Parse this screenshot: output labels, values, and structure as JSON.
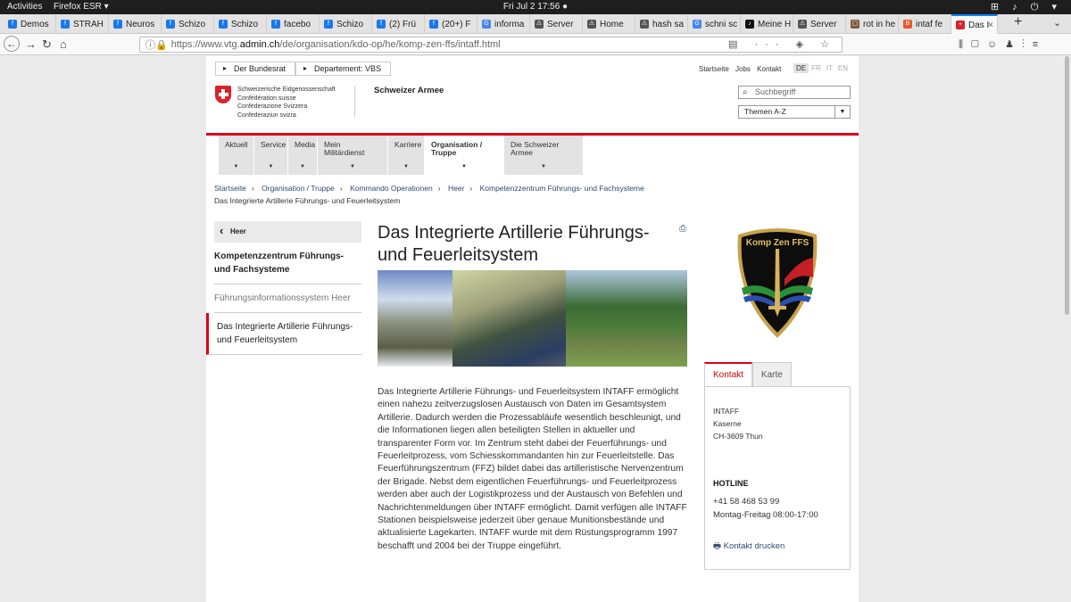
{
  "system": {
    "activities": "Activities",
    "app": "Firefox ESR ▾",
    "clock": "Fri Jul 2  17:56 ●",
    "tray": "⊞ ♪ ⏻ ▾"
  },
  "browser": {
    "tabs": [
      {
        "label": "Demos",
        "color": "#1877f2",
        "glyph": "f"
      },
      {
        "label": "STRAH",
        "color": "#1877f2",
        "glyph": "f"
      },
      {
        "label": "Neuros",
        "color": "#1877f2",
        "glyph": "f"
      },
      {
        "label": "Schizo",
        "color": "#1877f2",
        "glyph": "f"
      },
      {
        "label": "Schizo",
        "color": "#1877f2",
        "glyph": "f"
      },
      {
        "label": "facebo",
        "color": "#1877f2",
        "glyph": "f"
      },
      {
        "label": "Schizo",
        "color": "#1877f2",
        "glyph": "f"
      },
      {
        "label": "(2) Frü",
        "color": "#1877f2",
        "glyph": "f"
      },
      {
        "label": "(20+) F",
        "color": "#1877f2",
        "glyph": "f"
      },
      {
        "label": "informa",
        "color": "#4285f4",
        "glyph": "G"
      },
      {
        "label": "Server",
        "color": "#555",
        "glyph": "⚠"
      },
      {
        "label": "Home",
        "color": "#555",
        "glyph": "⚠"
      },
      {
        "label": "hash sa",
        "color": "#555",
        "glyph": "⚠"
      },
      {
        "label": "schni sc",
        "color": "#4285f4",
        "glyph": "G"
      },
      {
        "label": "Meine H",
        "color": "#111",
        "glyph": "♪"
      },
      {
        "label": "Server",
        "color": "#555",
        "glyph": "⚠"
      },
      {
        "label": "rot in he",
        "color": "#7a5a3a",
        "glyph": "▢"
      },
      {
        "label": "intaf fe",
        "color": "#e8562a",
        "glyph": "B"
      },
      {
        "label": "Das I",
        "color": "#d8232a",
        "glyph": "+"
      }
    ],
    "url_prefix": "https://www.vtg.",
    "url_host": "admin.ch",
    "url_path": "/de/organisation/kdo-op/he/komp-zen-ffs/intaff.html"
  },
  "site": {
    "breadcrumb_top": [
      "Der Bundesrat",
      "Departement: VBS"
    ],
    "utility_links": [
      "Startseite",
      "Jobs",
      "Kontakt"
    ],
    "languages": [
      "DE",
      "FR",
      "IT",
      "EN"
    ],
    "confederation": [
      "Schweizerische Eidgenossenschaft",
      "Confédération suisse",
      "Confederazione Svizzera",
      "Confederaziun svizra"
    ],
    "unit": "Schweizer Armee",
    "search_placeholder": "Suchbegriff",
    "themen": "Themen A-Z",
    "menu": [
      {
        "label": "Aktuell"
      },
      {
        "label": "Service"
      },
      {
        "label": "Media"
      },
      {
        "label": "Mein Militärdienst"
      },
      {
        "label": "Karriere"
      },
      {
        "label": "Organisation / Truppe"
      },
      {
        "label": "Die Schweizer Armee"
      }
    ],
    "crumbs": [
      "Startseite",
      "Organisation / Truppe",
      "Kommando Operationen",
      "Heer",
      "Kompetenzzentrum Führungs- und Fachsysteme"
    ],
    "crumb_current": "Das Integrierte Artillerie Führungs- und Feuerleitsystem",
    "subnav": {
      "back": "Heer",
      "items": [
        "Kompetenzzentrum Führungs- und Fachsysteme",
        "Führungsinformationssystem Heer",
        "Das Integrierte Artillerie Führungs- und Feuerleitsystem"
      ]
    },
    "title": "Das Integrierte Artillerie Führungs- und Feuerleitsystem",
    "body": "Das Integrierte Artillerie Führungs- und Feuerleitsystem INTAFF ermöglicht einen nahezu zeitverzugslosen Austausch von Daten im Gesamtsystem Artillerie. Dadurch werden die Prozessabläufe wesentlich beschleunigt, und die Informationen liegen allen beteiligten Stellen in aktueller und transparenter Form vor. Im Zentrum steht dabei der Feuerführungs- und Feuerleitprozess, vom Schiesskommandanten hin zur Feuerleitstelle. Das Feuerführungszentrum (FFZ) bildet dabei das artilleristische Nervenzentrum der Brigade. Nebst dem eigentlichen Feuerführungs- und Feuerleitprozess werden aber auch der Logistikprozess und der Austausch von Befehlen und Nachrichtenmeldungen über INTAFF ermöglicht. Damit verfügen alle INTAFF Stationen beispielsweise jederzeit über genaue Munitionsbestände und aktualisierte Lagekarten. INTAFF wurde mit dem Rüstungsprogramm 1997 beschafft und 2004 bei der Truppe eingeführt.",
    "badge_text": "Komp Zen FFS",
    "contact_tabs": [
      "Kontakt",
      "Karte"
    ],
    "address": [
      "INTAFF",
      "Kaserne",
      "CH-3609 Thun"
    ],
    "hotline_title": "HOTLINE",
    "phone": "+41 58 468 53 99",
    "hours": "Montag-Freitag 08:00-17:00",
    "print_contact": "Kontakt drucken",
    "accent": "#dc0018"
  }
}
